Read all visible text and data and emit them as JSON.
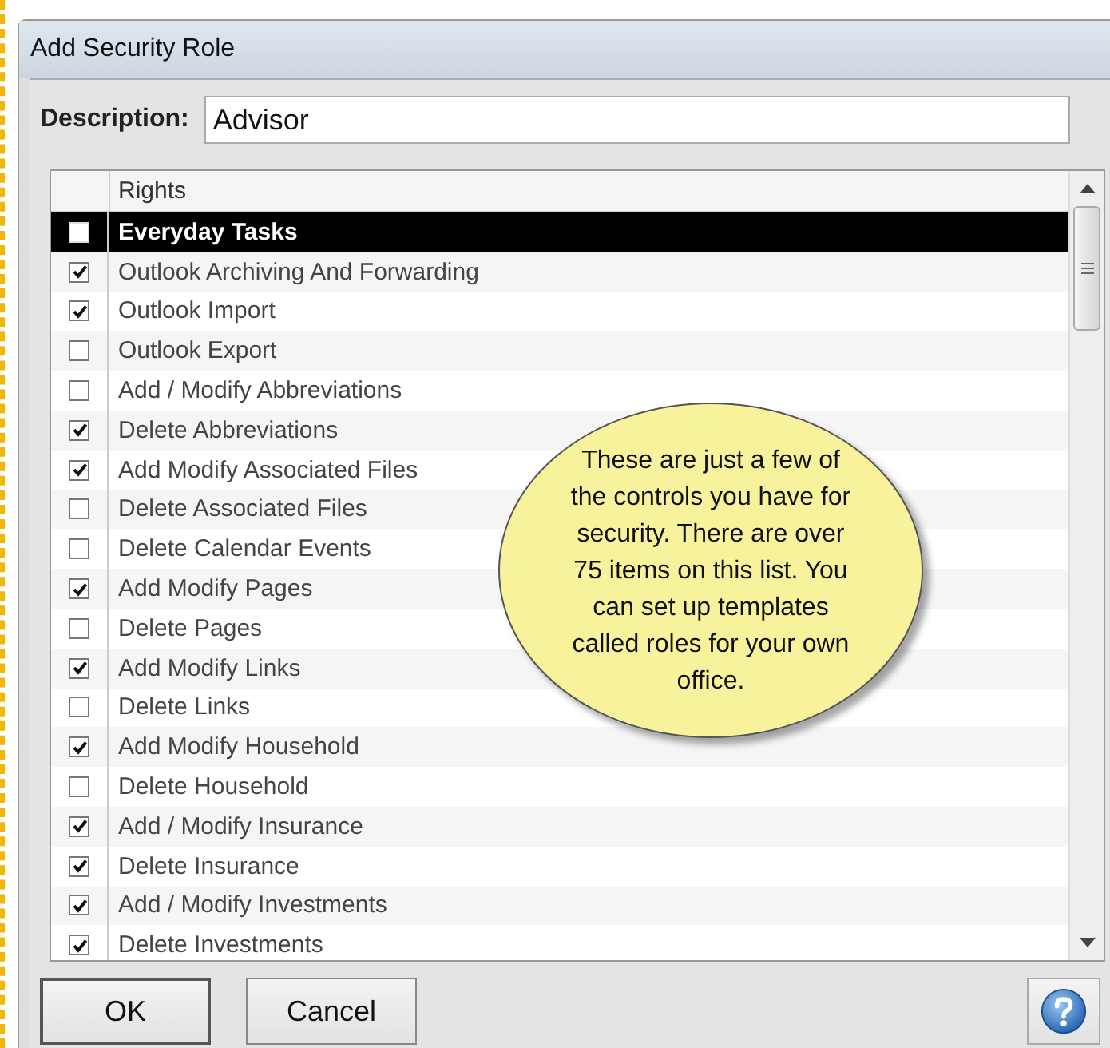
{
  "window": {
    "title": "Add Security Role"
  },
  "description": {
    "label": "Description:",
    "value": "Advisor"
  },
  "table": {
    "columns": [
      "Rights"
    ],
    "rows": [
      {
        "label": "Everyday Tasks",
        "checked": false,
        "selected": true
      },
      {
        "label": "Outlook Archiving And Forwarding",
        "checked": true,
        "selected": false
      },
      {
        "label": "Outlook Import",
        "checked": true,
        "selected": false
      },
      {
        "label": "Outlook Export",
        "checked": false,
        "selected": false
      },
      {
        "label": "Add / Modify Abbreviations",
        "checked": false,
        "selected": false
      },
      {
        "label": "Delete Abbreviations",
        "checked": true,
        "selected": false
      },
      {
        "label": "Add Modify Associated Files",
        "checked": true,
        "selected": false
      },
      {
        "label": "Delete Associated Files",
        "checked": false,
        "selected": false
      },
      {
        "label": "Delete Calendar Events",
        "checked": false,
        "selected": false
      },
      {
        "label": "Add Modify Pages",
        "checked": true,
        "selected": false
      },
      {
        "label": "Delete Pages",
        "checked": false,
        "selected": false
      },
      {
        "label": "Add Modify Links",
        "checked": true,
        "selected": false
      },
      {
        "label": "Delete Links",
        "checked": false,
        "selected": false
      },
      {
        "label": "Add Modify Household",
        "checked": true,
        "selected": false
      },
      {
        "label": "Delete Household",
        "checked": false,
        "selected": false
      },
      {
        "label": "Add / Modify Insurance",
        "checked": true,
        "selected": false
      },
      {
        "label": "Delete Insurance",
        "checked": true,
        "selected": false
      },
      {
        "label": "Add / Modify Investments",
        "checked": true,
        "selected": false
      },
      {
        "label": "Delete Investments",
        "checked": true,
        "selected": false
      }
    ]
  },
  "callout": {
    "lines": [
      "These are just a few of",
      "the controls you have for",
      "security.  There are over",
      "75 items on this list.  You",
      "can set up templates",
      "called roles for your own",
      "office."
    ]
  },
  "buttons": [
    "OK",
    "Cancel"
  ]
}
